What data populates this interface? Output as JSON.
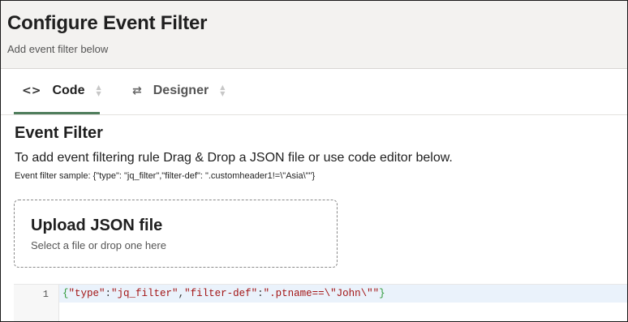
{
  "header": {
    "title": "Configure Event Filter",
    "subtitle": "Add event filter below"
  },
  "tabs": [
    {
      "label": "Code",
      "icon": "code-brackets-icon",
      "icon_glyph": "<>",
      "selected": true
    },
    {
      "label": "Designer",
      "icon": "swap-arrows-icon",
      "icon_glyph": "⇄",
      "selected": false
    }
  ],
  "section": {
    "title": "Event Filter",
    "instructions": "To add event filtering rule Drag & Drop a JSON file or use code editor below.",
    "sample": "Event filter sample: {\"type\": \"jq_filter\",\"filter-def\": \".customheader1!=\\\"Asia\\\"\"}"
  },
  "upload": {
    "title": "Upload JSON file",
    "hint": "Select a file or drop one here"
  },
  "editor": {
    "line_number": "1",
    "tokens": {
      "open": "{",
      "key1": "\"type\"",
      "colon1": ":",
      "val1": "\"jq_filter\"",
      "comma": ",",
      "key2": "\"filter-def\"",
      "colon2": ":",
      "val2": "\".ptname==\\\"John\\\"\"",
      "close": "}"
    }
  },
  "colors": {
    "tab_indicator": "#4f7d5c",
    "header_bg": "#f3f2f0",
    "active_line_bg": "#eaf2fb"
  }
}
